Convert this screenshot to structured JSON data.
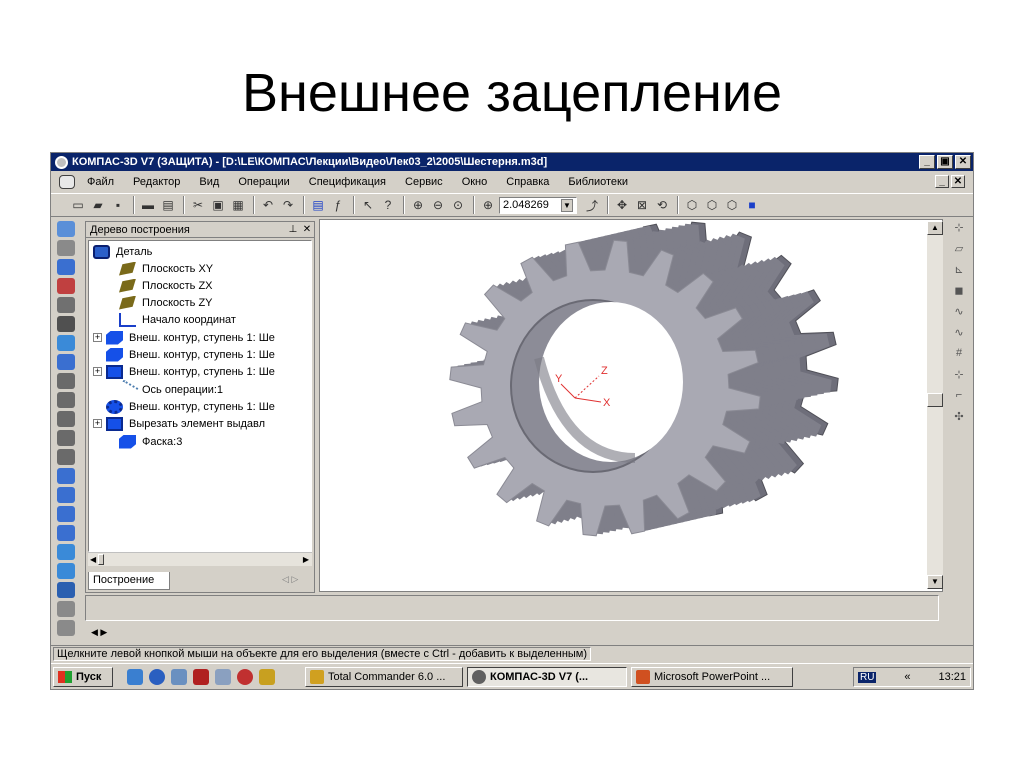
{
  "slide": {
    "title": "Внешнее зацепление"
  },
  "window": {
    "title": "КОМПАС-3D V7 (ЗАЩИТА) - [D:\\LE\\КОМПАС\\Лекции\\Видео\\Лек03_2\\2005\\Шестерня.m3d]",
    "minimize": "_",
    "maximize": "▣",
    "close": "✕"
  },
  "menu": {
    "items": [
      "Файл",
      "Редактор",
      "Вид",
      "Операции",
      "Спецификация",
      "Сервис",
      "Окно",
      "Справка",
      "Библиотеки"
    ]
  },
  "toolbar": {
    "zoom_value": "2.048269"
  },
  "tree": {
    "header": "Дерево построения",
    "pin": "⊥",
    "close": "✕",
    "tab_label": "Построение",
    "items": [
      {
        "label": "Деталь",
        "icon": "part-icon"
      },
      {
        "label": "Плоскость XY",
        "icon": "plane-icon"
      },
      {
        "label": "Плоскость ZX",
        "icon": "plane-icon"
      },
      {
        "label": "Плоскость ZY",
        "icon": "plane-icon"
      },
      {
        "label": "Начало координат",
        "icon": "origin-icon"
      },
      {
        "label": "Внеш. контур, ступень 1: Ше",
        "icon": "extrude-icon",
        "expander": "+"
      },
      {
        "label": "Внеш. контур, ступень 1: Ше",
        "icon": "extrude-icon"
      },
      {
        "label": "Внеш. контур, ступень 1: Ше",
        "icon": "extrude-box-icon",
        "expander": "+"
      },
      {
        "label": "Ось операции:1",
        "icon": "axis-icon"
      },
      {
        "label": "Внеш. контур, ступень 1: Ше",
        "icon": "gear-icon"
      },
      {
        "label": "Вырезать элемент выдавл",
        "icon": "cut-icon",
        "expander": "+"
      },
      {
        "label": "Фаска:3",
        "icon": "chamfer-icon"
      }
    ]
  },
  "status": {
    "hint": "Щелкните левой кнопкой мыши на объекте для его выделения (вместе с Ctrl - добавить к выделенным)"
  },
  "taskbar": {
    "start": "Пуск",
    "tasks": [
      {
        "label": "Total Commander 6.0 ...",
        "active": false
      },
      {
        "label": "КОМПАС-3D V7 (...",
        "active": true
      },
      {
        "label": "Microsoft PowerPoint ...",
        "active": false
      }
    ],
    "lang": "RU",
    "arrows": "«",
    "clock": "13:21"
  },
  "triad": {
    "x": "X",
    "y": "Y",
    "z": "Z"
  },
  "colors": {
    "title_bar": "#0a246a",
    "gear": "#a6a6b0",
    "tree_icons": "#1550e8"
  }
}
